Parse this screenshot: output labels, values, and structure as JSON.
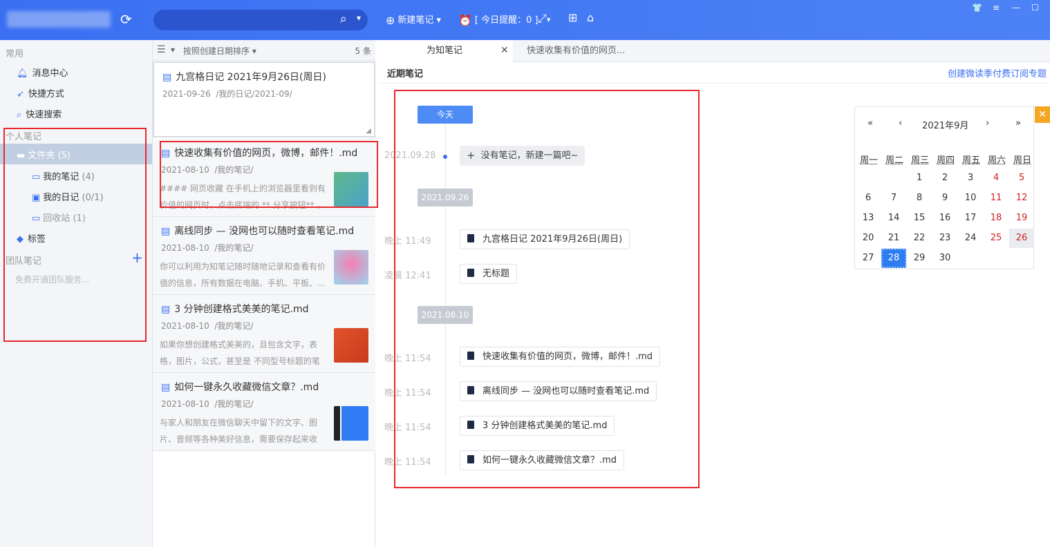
{
  "toolbar": {
    "new_note": "新建笔记",
    "reminder": "[ 今日提醒：0 ]"
  },
  "sidebar": {
    "common": "常用",
    "common_items": [
      "消息中心",
      "快捷方式",
      "快速搜索"
    ],
    "personal": "个人笔记",
    "folder": "文件夹 (5)",
    "sub_items": [
      {
        "label": "我的笔记",
        "count": "(4)"
      },
      {
        "label": "我的日记",
        "count": "(0/1)"
      },
      {
        "label": "回收站",
        "count": "(1)"
      }
    ],
    "tags": "标签",
    "team": "团队笔记",
    "team_promo": "免费开通团队服务..."
  },
  "list": {
    "sort_label": "按照创建日期排序",
    "count": "5 条",
    "notes": [
      {
        "title": "九宫格日记 2021年9月26日(周日)",
        "date": "2021-09-26",
        "path": "/我的日记/2021-09/",
        "snippet": ""
      },
      {
        "title": "快速收集有价值的网页，微博，邮件！.md",
        "date": "2021-08-10",
        "path": "/我的笔记/",
        "snippet": "#### 网页收藏 在手机上的浏览器里看到有价值的网页时，点击底端的 ** 分享按钮** ，选..."
      },
      {
        "title": "离线同步 — 没网也可以随时查看笔记.md",
        "date": "2021-08-10",
        "path": "/我的笔记/",
        "snippet": "你可以利用为知笔记随时随地记录和查看有价值的信息，所有数据在电脑、手机、平板、..."
      },
      {
        "title": "3 分钟创建格式美美的笔记.md",
        "date": "2021-08-10",
        "path": "/我的笔记/",
        "snippet": "如果你想创建格式美美的，且包含文字，表格，图片，公式，甚至是 不同型号标题的笔记..."
      },
      {
        "title": "如何一键永久收藏微信文章？.md",
        "date": "2021-08-10",
        "path": "/我的笔记/",
        "snippet": " 与家人和朋友在微信聊天中留下的文字、图片、音频等各种美好信息，需要保存起来收好？..."
      }
    ]
  },
  "tabs": [
    "为知笔记",
    "快速收集有价值的网页..."
  ],
  "main": {
    "recent_title": "近期笔记",
    "promo_link": "创建微读季付费订阅专题",
    "today": "今天",
    "today_date": "2021.09.28",
    "new_hint": "没有笔记，新建一篇吧~",
    "groups": [
      {
        "date": "2021.09.26",
        "items": [
          {
            "time": "晚上 11:49",
            "title": "九宫格日记 2021年9月26日(周日)"
          },
          {
            "time": "凌晨 12:41",
            "title": "无标题"
          }
        ]
      },
      {
        "date": "2021.08.10",
        "items": [
          {
            "time": "晚上 11:54",
            "title": "快速收集有价值的网页，微博，邮件！.md"
          },
          {
            "time": "晚上 11:54",
            "title": "离线同步 — 没网也可以随时查看笔记.md"
          },
          {
            "time": "晚上 11:54",
            "title": "3 分钟创建格式美美的笔记.md"
          },
          {
            "time": "晚上 11:54",
            "title": "如何一键永久收藏微信文章？.md"
          }
        ]
      }
    ]
  },
  "calendar": {
    "title": "2021年9月",
    "nav": [
      "«",
      "‹",
      "›",
      "»"
    ],
    "weekdays": [
      "周一",
      "周二",
      "周三",
      "周四",
      "周五",
      "周六",
      "周日"
    ],
    "weeks": [
      [
        "",
        "",
        "1",
        "2",
        "3",
        "4",
        "5"
      ],
      [
        "6",
        "7",
        "8",
        "9",
        "10",
        "11",
        "12"
      ],
      [
        "13",
        "14",
        "15",
        "16",
        "17",
        "18",
        "19"
      ],
      [
        "20",
        "21",
        "22",
        "23",
        "24",
        "25",
        "26"
      ],
      [
        "27",
        "28",
        "29",
        "30",
        "",
        "",
        ""
      ]
    ],
    "selected": "28",
    "close": "✕"
  },
  "colors": {
    "accent": "#3a6ff2",
    "highlight": "#e8262b",
    "weekend": "#d0201f"
  }
}
